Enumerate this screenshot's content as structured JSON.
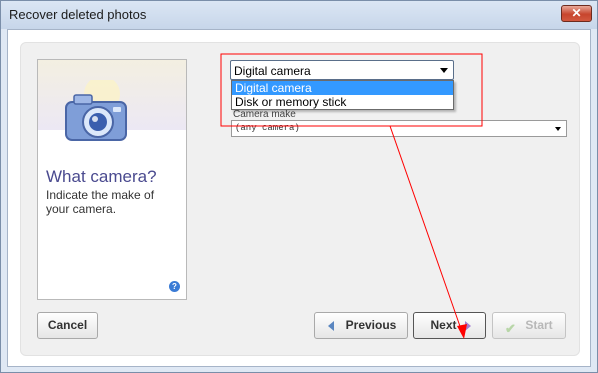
{
  "window": {
    "title": "Recover deleted photos",
    "close_label": "✕"
  },
  "side": {
    "icon": "camera-icon",
    "heading": "What camera?",
    "description": "Indicate the make of your camera.",
    "help_label": "?"
  },
  "source_select": {
    "value": "Digital camera",
    "options": [
      "Digital camera",
      "Disk or memory stick"
    ],
    "highlighted_option": "Digital camera"
  },
  "camera_make": {
    "label": "Camera make",
    "value": "(any camera)"
  },
  "buttons": {
    "cancel": "Cancel",
    "previous": "Previous",
    "next": "Next",
    "start": "Start"
  },
  "colors": {
    "annotation": "#ff0000",
    "highlight": "#3399ff",
    "heading": "#4a4a8f"
  }
}
